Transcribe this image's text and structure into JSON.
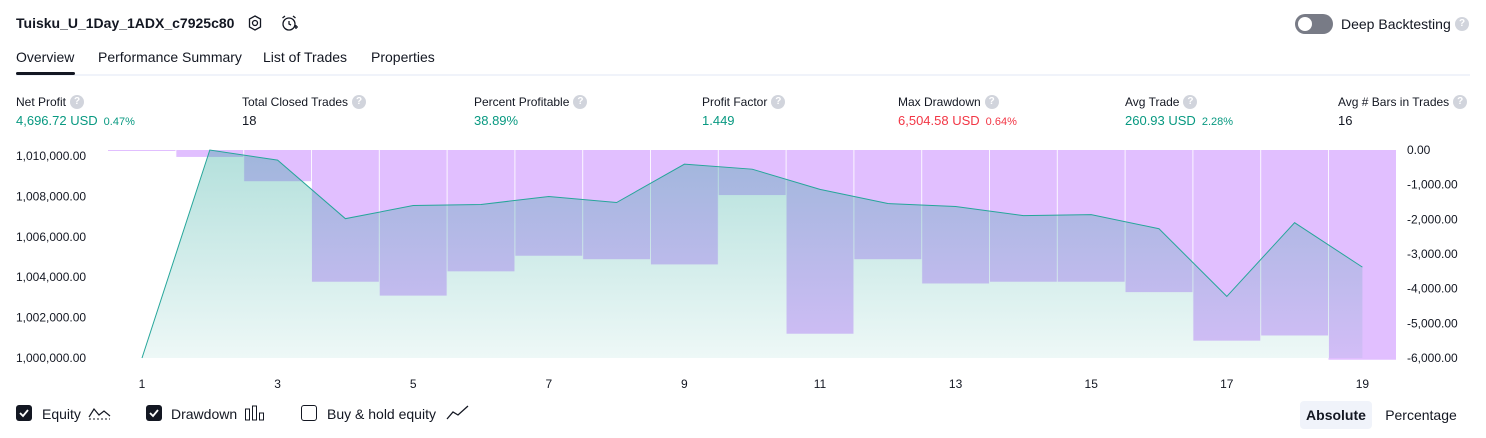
{
  "header": {
    "strategy_title": "Tuisku_U_1Day_1ADX_c7925c80",
    "deep_backtesting_label": "Deep Backtesting",
    "deep_backtesting_enabled": false,
    "help_glyph": "?"
  },
  "tabs": [
    {
      "label": "Overview",
      "active": true
    },
    {
      "label": "Performance Summary",
      "active": false
    },
    {
      "label": "List of Trades",
      "active": false
    },
    {
      "label": "Properties",
      "active": false
    }
  ],
  "metrics": [
    {
      "label": "Net Profit",
      "value": "4,696.72 USD",
      "sub": "0.47%",
      "color": "#089981"
    },
    {
      "label": "Total Closed Trades",
      "value": "18",
      "sub": "",
      "color": "#131722"
    },
    {
      "label": "Percent Profitable",
      "value": "38.89%",
      "sub": "",
      "color": "#089981"
    },
    {
      "label": "Profit Factor",
      "value": "1.449",
      "sub": "",
      "color": "#089981"
    },
    {
      "label": "Max Drawdown",
      "value": "6,504.58 USD",
      "sub": "0.64%",
      "color": "#f23645"
    },
    {
      "label": "Avg Trade",
      "value": "260.93 USD",
      "sub": "2.28%",
      "color": "#089981"
    },
    {
      "label": "Avg # Bars in Trades",
      "value": "16",
      "sub": "",
      "color": "#131722"
    }
  ],
  "legend": {
    "equity_label": "Equity",
    "drawdown_label": "Drawdown",
    "buy_hold_label": "Buy & hold equity",
    "equity_checked": true,
    "drawdown_checked": true,
    "buy_hold_checked": false,
    "absolute_label": "Absolute",
    "percentage_label": "Percentage",
    "absolute_selected": true
  },
  "chart_data": {
    "type": "area",
    "x": [
      1,
      2,
      3,
      4,
      5,
      6,
      7,
      8,
      9,
      10,
      11,
      12,
      13,
      14,
      15,
      16,
      17,
      18,
      19
    ],
    "x_ticks": [
      1,
      3,
      5,
      7,
      9,
      11,
      13,
      15,
      17,
      19
    ],
    "equity": [
      1000000,
      1010300,
      1009800,
      1006900,
      1007550,
      1007600,
      1008000,
      1007700,
      1009600,
      1009350,
      1008350,
      1007650,
      1007500,
      1007050,
      1007100,
      1006400,
      1003050,
      1006700,
      1004500
    ],
    "drawdown": [
      0,
      -200,
      -900,
      -3800,
      -4200,
      -3500,
      -3050,
      -3150,
      -3300,
      -1300,
      -5300,
      -3150,
      -3850,
      -3800,
      -3800,
      -4100,
      -5500,
      -5350,
      -6050
    ],
    "y_left_ticks": [
      "1,000,000.00",
      "1,002,000.00",
      "1,004,000.00",
      "1,006,000.00",
      "1,008,000.00",
      "1,010,000.00"
    ],
    "y_left_range": [
      1000000,
      1010300
    ],
    "y_right_ticks": [
      "0.00",
      "-1,000.00",
      "-2,000.00",
      "-3,000.00",
      "-4,000.00",
      "-5,000.00",
      "-6,000.00"
    ],
    "y_right_range": [
      -6000,
      0
    ],
    "colors": {
      "equity_line": "#26a69a",
      "drawdown_fill": "#e1bfff",
      "overlap": "#b4b8e8"
    }
  }
}
